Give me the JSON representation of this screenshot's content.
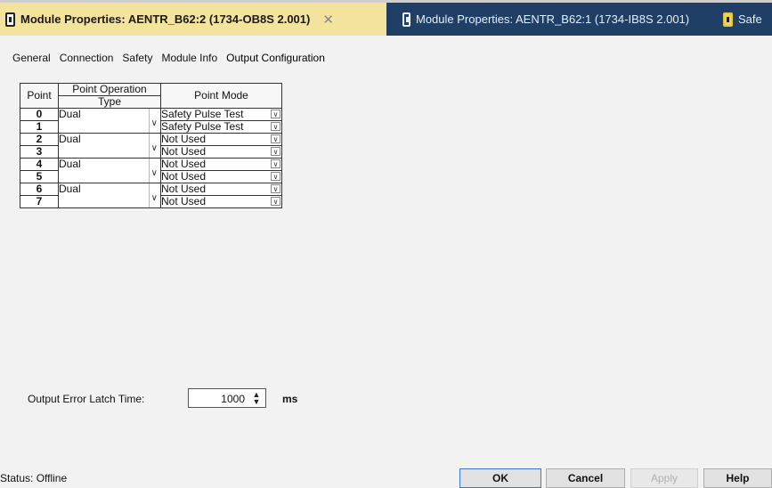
{
  "doc_tabs": [
    {
      "label": "Module Properties: AENTR_B62:2 (1734-OB8S 2.001)",
      "active": true
    },
    {
      "label": "Module Properties: AENTR_B62:1 (1734-IB8S 2.001)",
      "active": false
    },
    {
      "label": "Safe",
      "active": false
    }
  ],
  "property_tabs": [
    "General",
    "Connection",
    "Safety",
    "Module Info",
    "Output Configuration"
  ],
  "active_property_tab": "Output Configuration",
  "table": {
    "header_point": "Point",
    "header_op_top": "Point Operation",
    "header_op_bottom": "Type",
    "header_mode": "Point Mode",
    "pairs": [
      {
        "points": [
          "0",
          "1"
        ],
        "operation": "Dual",
        "modes": [
          "Safety Pulse Test",
          "Safety Pulse Test"
        ]
      },
      {
        "points": [
          "2",
          "3"
        ],
        "operation": "Dual",
        "modes": [
          "Not Used",
          "Not Used"
        ]
      },
      {
        "points": [
          "4",
          "5"
        ],
        "operation": "Dual",
        "modes": [
          "Not Used",
          "Not Used"
        ]
      },
      {
        "points": [
          "6",
          "7"
        ],
        "operation": "Dual",
        "modes": [
          "Not Used",
          "Not Used"
        ]
      }
    ]
  },
  "latch": {
    "label": "Output Error Latch Time:",
    "value": "1000",
    "unit": "ms"
  },
  "status": "Status:  Offline",
  "buttons": {
    "ok": "OK",
    "cancel": "Cancel",
    "apply": "Apply",
    "help": "Help"
  }
}
